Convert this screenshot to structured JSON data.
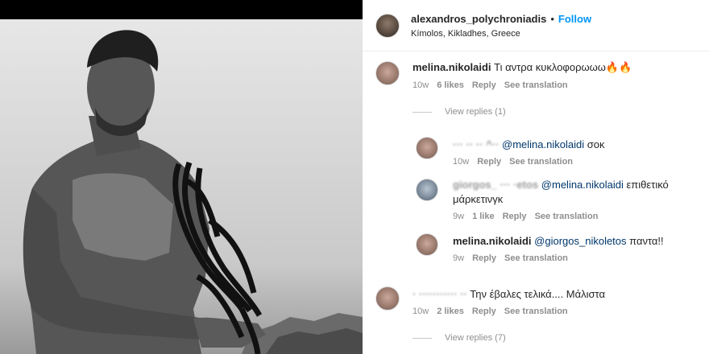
{
  "post": {
    "author": "alexandros_polychroniadis",
    "follow_label": "Follow",
    "separator": "•",
    "location": "Kímolos, Kikladhes, Greece"
  },
  "comments": [
    {
      "user": "melina.nikolaidi",
      "text": "Τι αντρα κυκλοφορωωω🔥🔥",
      "time": "10w",
      "likes": "6 likes",
      "reply": "Reply",
      "translate": "See translation",
      "view_replies": "View replies (1)"
    },
    {
      "user_obscured": "··· ·· ·· ^··",
      "mention": "@melina.nikolaidi",
      "text": "σοκ",
      "time": "10w",
      "reply": "Reply",
      "translate": "See translation"
    },
    {
      "user_obscured": "giorgos_ ··· ·etos",
      "mention": "@melina.nikolaidi",
      "text": "επιθετικό",
      "text_line2": "μάρκετινγκ",
      "time": "9w",
      "likes": "1 like",
      "reply": "Reply",
      "translate": "See translation"
    },
    {
      "user": "melina.nikolaidi",
      "mention": "@giorgos_nikoletos",
      "text": "παντα!!",
      "time": "9w",
      "reply": "Reply",
      "translate": "See translation"
    },
    {
      "user_obscured": "· ··········· ··",
      "text": "Την έβαλες τελικά.... Μάλιστα",
      "time": "10w",
      "likes": "2 likes",
      "reply": "Reply",
      "translate": "See translation",
      "view_replies": "View replies (7)"
    }
  ]
}
